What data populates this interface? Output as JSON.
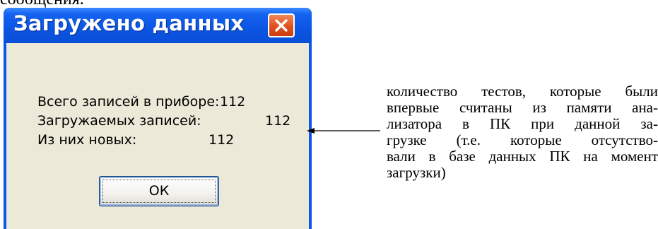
{
  "page_caption": "сообщения.",
  "dialog": {
    "title": "Загружено данных",
    "rows": [
      {
        "label": "Всего записей в приборе:",
        "value": "112"
      },
      {
        "label": "Загружаемых записей:",
        "value": "112"
      },
      {
        "label": "Из них новых:",
        "value": "112"
      }
    ],
    "ok_label": "ОК"
  },
  "annotation": {
    "lines": [
      "количество тестов, которые были",
      "впервые считаны из памяти ана-",
      "лизатора в ПК при данной за-",
      "грузке (т.е. которые отсутство-",
      "вали в базе данных ПК на момент",
      "загрузки)"
    ]
  },
  "colors": {
    "titlebar": "#0a56e8",
    "dialog_body": "#ece9d8",
    "close_button": "#e0501e"
  },
  "icons": {
    "close": "close-icon",
    "arrow": "arrow-left-icon"
  }
}
